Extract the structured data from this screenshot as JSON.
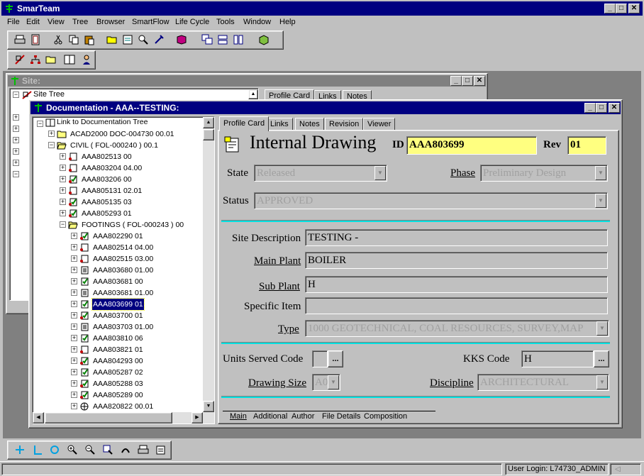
{
  "app": {
    "title": "SmarTeam"
  },
  "menu": [
    "File",
    "Edit",
    "View",
    "Tree",
    "Browser",
    "SmartFlow",
    "Life Cycle",
    "Tools",
    "Window",
    "Help"
  ],
  "site": {
    "title": "Site:",
    "tree_label": "Site Tree",
    "tabs": [
      "Profile Card",
      "Links",
      "Notes"
    ]
  },
  "doc": {
    "title": "Documentation - AAA--TESTING:",
    "tree_root": "Link to Documentation Tree",
    "tree": [
      {
        "label": "ACAD2000 DOC-004730 00.01",
        "level": 1,
        "icon": "folder-icon"
      },
      {
        "label": "CIVIL     ( FOL-000240 ) 00.1",
        "level": 1,
        "icon": "folder-open-icon"
      },
      {
        "label": "AAA802513 00",
        "level": 2,
        "icon": "drawing-icon"
      },
      {
        "label": "AAA803204 04.00",
        "level": 2,
        "icon": "drawing-icon"
      },
      {
        "label": "AAA803206 00",
        "level": 2,
        "icon": "checked-drawing-icon"
      },
      {
        "label": "AAA805131 02.01",
        "level": 2,
        "icon": "drawing-icon"
      },
      {
        "label": "AAA805135 03",
        "level": 2,
        "icon": "checked-drawing-icon"
      },
      {
        "label": "AAA805293 01",
        "level": 2,
        "icon": "checked-drawing-icon"
      },
      {
        "label": "FOOTINGS     ( FOL-000243 ) 00",
        "level": 2,
        "icon": "folder-open-icon"
      },
      {
        "label": "AAA802290 01",
        "level": 3,
        "icon": "checked-drawing-icon"
      },
      {
        "label": "AAA802514 04.00",
        "level": 3,
        "icon": "drawing-icon"
      },
      {
        "label": "AAA802515 03.00",
        "level": 3,
        "icon": "drawing-icon"
      },
      {
        "label": "AAA803680 01.00",
        "level": 3,
        "icon": "document-icon"
      },
      {
        "label": "AAA803681 00",
        "level": 3,
        "icon": "checked-icon"
      },
      {
        "label": "AAA803681 01.00",
        "level": 3,
        "icon": "document-icon"
      },
      {
        "label": "AAA803699 01",
        "level": 3,
        "icon": "checked-icon",
        "selected": true
      },
      {
        "label": "AAA803700 01",
        "level": 3,
        "icon": "checked-drawing-icon"
      },
      {
        "label": "AAA803703 01.00",
        "level": 3,
        "icon": "document-icon"
      },
      {
        "label": "AAA803810 06",
        "level": 3,
        "icon": "checked-icon"
      },
      {
        "label": "AAA803821 01",
        "level": 3,
        "icon": "drawing-icon"
      },
      {
        "label": "AAA804293 00",
        "level": 3,
        "icon": "checked-drawing-icon"
      },
      {
        "label": "AAA805287 02",
        "level": 3,
        "icon": "checked-icon"
      },
      {
        "label": "AAA805288 03",
        "level": 3,
        "icon": "checked-drawing-icon"
      },
      {
        "label": "AAA805289 00",
        "level": 3,
        "icon": "checked-drawing-icon"
      },
      {
        "label": "AAA820822 00.01",
        "level": 3,
        "icon": "globe-icon"
      }
    ],
    "tabs": [
      "Profile Card",
      "Links",
      "Notes",
      "Revision",
      "Viewer"
    ],
    "profile": {
      "class_title": "Internal Drawing",
      "id_label": "ID",
      "id_value": "AAA803699",
      "rev_label": "Rev",
      "rev_value": "01",
      "state_label": "State",
      "state_value": "Released",
      "phase_label": "Phase",
      "phase_value": "Preliminary Design",
      "status_label": "Status",
      "status_value": "APPROVED",
      "site_desc_label": "Site Description",
      "site_desc_value": "TESTING -",
      "main_plant_label": "Main Plant",
      "main_plant_value": "BOILER",
      "sub_plant_label": "Sub Plant",
      "sub_plant_value": "H",
      "specific_item_label": "Specific Item",
      "specific_item_value": "",
      "type_label": "Type",
      "type_value": "1000 GEOTECHNICAL, COAL RESOURCES, SURVEY,MAP",
      "units_label": "Units Served Code",
      "units_value": "",
      "kks_label": "KKS Code",
      "kks_value": "H",
      "drawing_size_label": "Drawing Size",
      "drawing_size_value": "A0",
      "discipline_label": "Discipline",
      "discipline_value": "ARCHITECTURAL",
      "ellipsis": "..."
    },
    "bottom_tabs": [
      "Main",
      "Additional",
      "Author",
      "File Details",
      "Composition"
    ]
  },
  "status": {
    "login": "User Login: L74730_ADMIN"
  },
  "colors": {
    "title_active": "#000080",
    "title_inactive": "#808080",
    "highlight": "#ffff80",
    "separator": "#00e0e0"
  }
}
